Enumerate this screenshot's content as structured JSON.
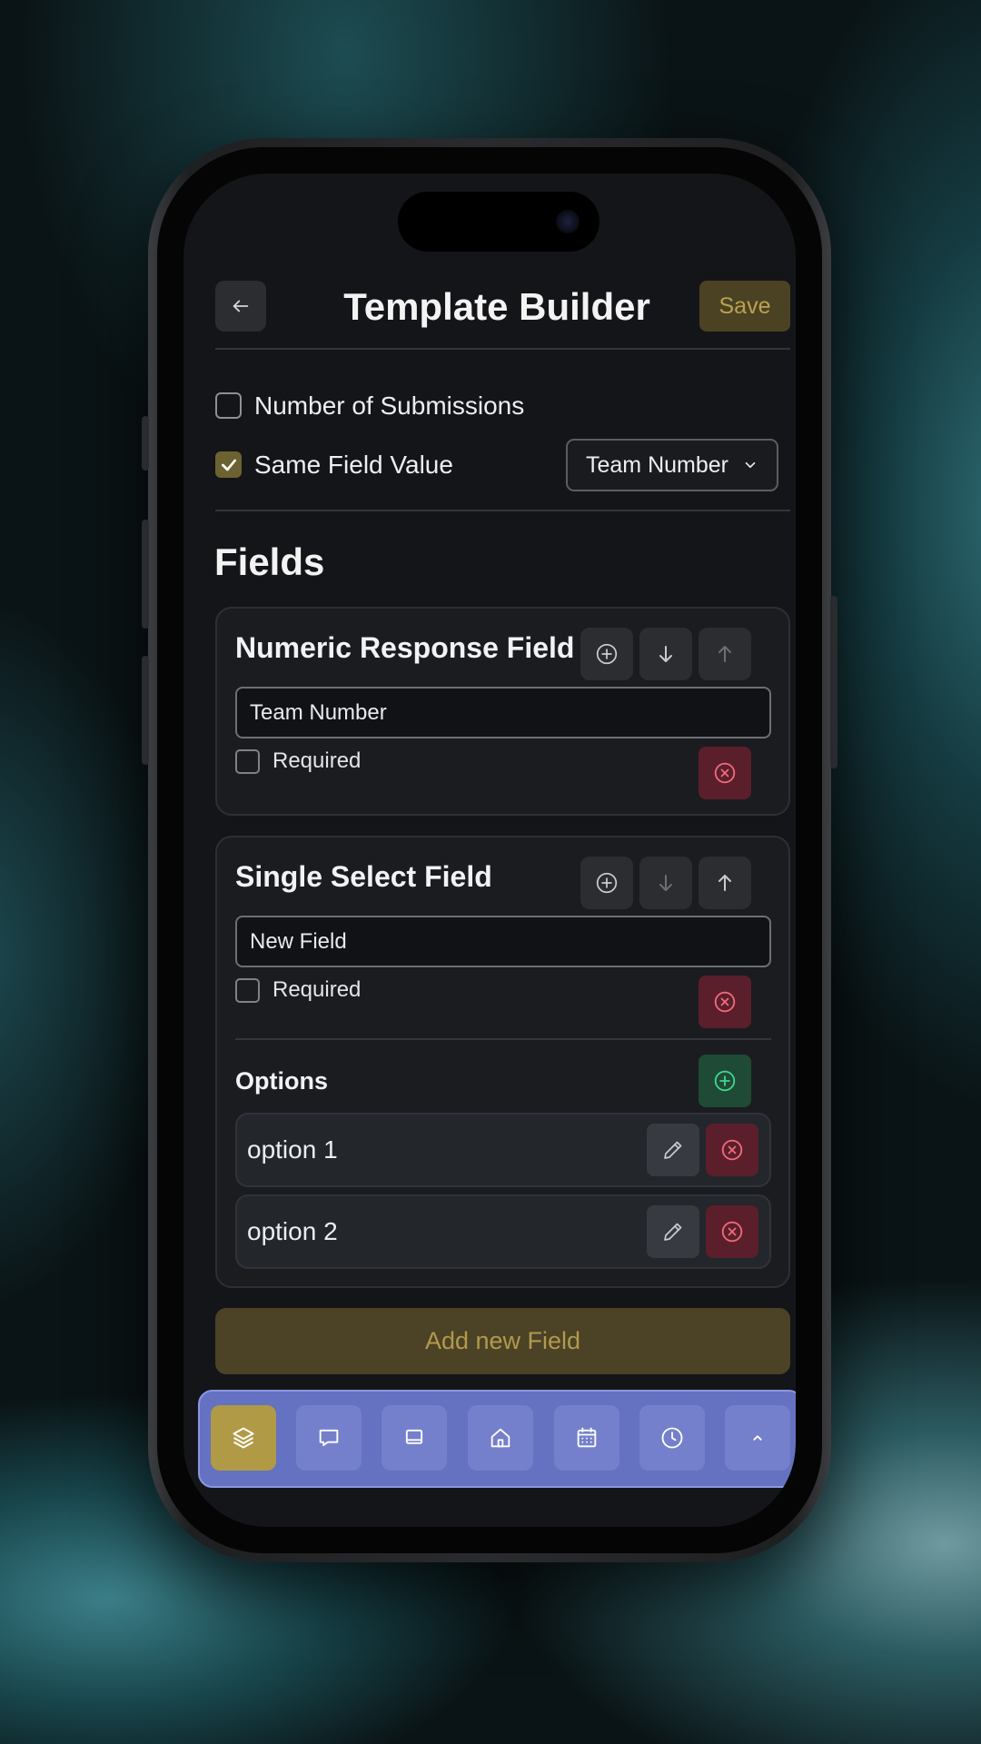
{
  "header": {
    "title": "Template Builder",
    "save_label": "Save",
    "back_icon": "arrow-left-icon"
  },
  "filters": {
    "submissions": {
      "label": "Number of Submissions",
      "checked": false
    },
    "same_value": {
      "label": "Same Field Value",
      "checked": true
    },
    "field_select": {
      "value": "Team Number"
    }
  },
  "fields_section": {
    "title": "Fields"
  },
  "fields": [
    {
      "title": "Numeric Response Field",
      "input_value": "Team Number",
      "required_label": "Required",
      "required": false
    },
    {
      "title": "Single Select Field",
      "input_value": "New Field",
      "required_label": "Required",
      "required": false,
      "options_title": "Options",
      "options": [
        "option 1",
        "option 2"
      ]
    }
  ],
  "add_field_label": "Add new Field",
  "nav": {
    "items": [
      "layers-icon",
      "chat-icon",
      "tablet-icon",
      "home-icon",
      "calendar-icon",
      "clock-icon",
      "chevron-up-icon"
    ],
    "active_index": 0
  },
  "colors": {
    "accent": "#b09a45",
    "danger": "#5a1f2b",
    "success": "#1f4a36",
    "nav": "#6571c1"
  }
}
